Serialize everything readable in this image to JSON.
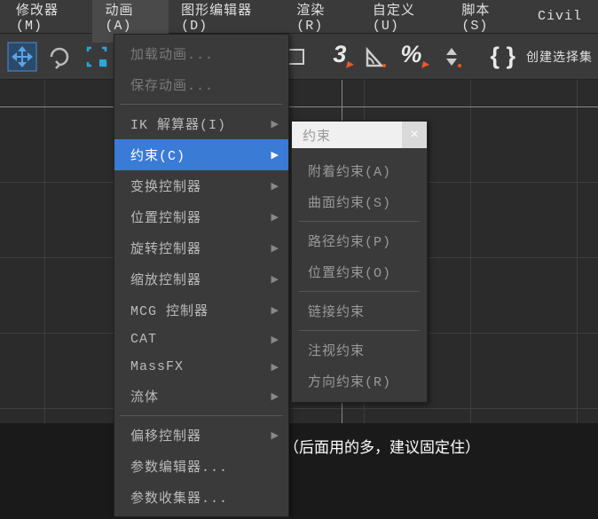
{
  "menubar": {
    "items": [
      {
        "label": "修改器(M)"
      },
      {
        "label": "动画(A)"
      },
      {
        "label": "图形编辑器(D)"
      },
      {
        "label": "渲染(R)"
      },
      {
        "label": "自定义(U)"
      },
      {
        "label": "脚本(S)"
      },
      {
        "label": "Civil"
      }
    ]
  },
  "toolbar": {
    "three": "3",
    "percent": "%",
    "braces": "{ }",
    "selectset": "创建选择集"
  },
  "dropdown": {
    "items": [
      {
        "label": "加载动画...",
        "disabled": true
      },
      {
        "label": "保存动画...",
        "disabled": true
      },
      {
        "sep": true
      },
      {
        "label": "IK 解算器(I)",
        "submenu": true
      },
      {
        "label": "约束(C)",
        "submenu": true,
        "hl": true
      },
      {
        "label": "变换控制器",
        "submenu": true
      },
      {
        "label": "位置控制器",
        "submenu": true
      },
      {
        "label": "旋转控制器",
        "submenu": true
      },
      {
        "label": "缩放控制器",
        "submenu": true
      },
      {
        "label": "MCG 控制器",
        "submenu": true
      },
      {
        "label": "CAT",
        "submenu": true
      },
      {
        "label": "MassFX",
        "submenu": true
      },
      {
        "label": "流体",
        "submenu": true
      },
      {
        "sep": true
      },
      {
        "label": "偏移控制器",
        "submenu": true
      },
      {
        "label": "参数编辑器..."
      },
      {
        "label": "参数收集器..."
      }
    ]
  },
  "submenu": {
    "title": "约束",
    "items": [
      {
        "label": "附着约束(A)"
      },
      {
        "label": "曲面约束(S)"
      },
      {
        "sep": true
      },
      {
        "label": "路径约束(P)"
      },
      {
        "label": "位置约束(O)"
      },
      {
        "sep": true
      },
      {
        "label": "链接约束"
      },
      {
        "sep": true
      },
      {
        "label": "注视约束"
      },
      {
        "label": "方向约束(R)"
      }
    ]
  },
  "caption": "咋们把约束面板先调出来（后面用的多，建议固定住）"
}
